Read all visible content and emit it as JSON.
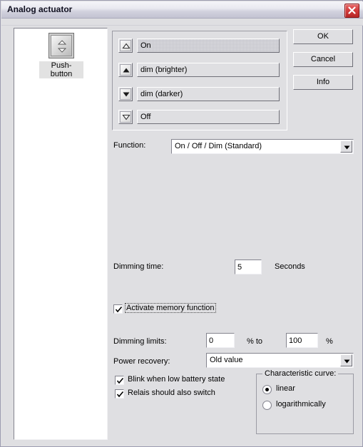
{
  "window": {
    "title": "Analog actuator",
    "close_icon": "close-x-icon",
    "close_color": "#c62828"
  },
  "device_panel": {
    "item_label": "Push-button",
    "item_icon": "rocker-switch-icon"
  },
  "rocker_list": {
    "rows": [
      {
        "icon": "chevron-up-outline-icon",
        "value": "On",
        "focused": true
      },
      {
        "icon": "chevron-up-filled-icon",
        "value": "dim (brighter)",
        "focused": false
      },
      {
        "icon": "chevron-down-filled-icon",
        "value": "dim (darker)",
        "focused": false
      },
      {
        "icon": "chevron-down-outline-icon",
        "value": "Off",
        "focused": false
      }
    ]
  },
  "buttons": {
    "ok": "OK",
    "cancel": "Cancel",
    "info": "Info"
  },
  "function": {
    "label": "Function:",
    "value": "On / Off / Dim (Standard)",
    "options": [
      "On / Off / Dim (Standard)"
    ]
  },
  "dimming_time": {
    "label": "Dimming time:",
    "value": "5",
    "unit": "Seconds"
  },
  "memory": {
    "label": "Activate memory function",
    "checked": true
  },
  "dimming_limits": {
    "label": "Dimming limits:",
    "min": "0",
    "mid_unit": "% to",
    "max": "100",
    "end_unit": "%"
  },
  "power_recovery": {
    "label": "Power recovery:",
    "value": "Old value",
    "options": [
      "Old value"
    ]
  },
  "options": [
    {
      "label": "Blink when low battery state",
      "checked": true
    },
    {
      "label": "Relais should also switch",
      "checked": true
    }
  ],
  "characteristic_curve": {
    "legend": "Characteristic curve:",
    "items": [
      {
        "label": "linear",
        "selected": true
      },
      {
        "label": "logarithmically",
        "selected": false
      }
    ]
  }
}
